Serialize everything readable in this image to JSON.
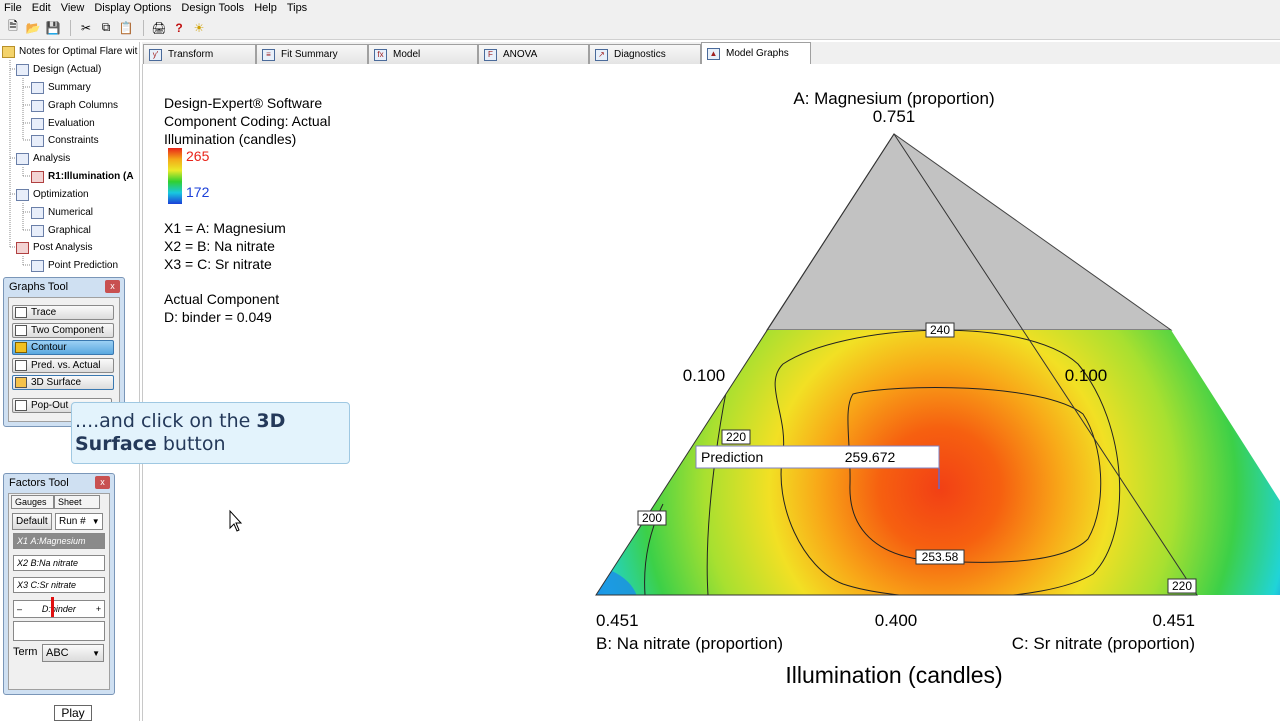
{
  "menu": [
    "File",
    "Edit",
    "View",
    "Display Options",
    "Design Tools",
    "Help",
    "Tips"
  ],
  "toolbar_icons": [
    "new-file-icon",
    "open-folder-icon",
    "save-icon",
    "cut-icon",
    "copy-icon",
    "paste-icon",
    "print-icon",
    "help-icon",
    "tip-bulb-icon"
  ],
  "tree": {
    "root": "Notes for Optimal Flare wit",
    "design": "Design (Actual)",
    "summary": "Summary",
    "graph_columns": "Graph Columns",
    "evaluation": "Evaluation",
    "constraints": "Constraints",
    "analysis": "Analysis",
    "response": "R1:Illumination (A",
    "optimization": "Optimization",
    "numerical": "Numerical",
    "graphical": "Graphical",
    "post_analysis": "Post Analysis",
    "point_prediction": "Point Prediction"
  },
  "graphs_tool": {
    "title": "Graphs Tool",
    "close": "x",
    "buttons": [
      "Trace",
      "Two Component",
      "Contour",
      "Pred. vs. Actual",
      "3D Surface",
      "Pop-Out"
    ]
  },
  "callout": {
    "line1": "....and click on the ",
    "bold1": "3D",
    "bold2": "Surface",
    "line2": " button"
  },
  "factors_tool": {
    "title": "Factors Tool",
    "close": "x",
    "tab_gauges": "Gauges",
    "tab_sheet": "Sheet",
    "default_btn": "Default",
    "run_select": "Run #",
    "factors": [
      {
        "code": "X1",
        "name": "A:Magnesium"
      },
      {
        "code": "X2",
        "name": "B:Na nitrate"
      },
      {
        "code": "X3",
        "name": "C:Sr nitrate"
      }
    ],
    "slider_minus": "–",
    "slider_label": "D:binder",
    "slider_plus": "+",
    "term_label": "Term",
    "term_value": "ABC"
  },
  "play_button": "Play",
  "tabs": [
    "Transform",
    "Fit Summary",
    "Model",
    "ANOVA",
    "Diagnostics",
    "Model Graphs"
  ],
  "active_tab": "Model Graphs",
  "legend": {
    "software": "Design-Expert® Software",
    "coding": "Component Coding: Actual",
    "response": "Illumination (candles)",
    "max_value": "265",
    "min_value": "172",
    "x1": "X1 = A: Magnesium",
    "x2": "X2 = B: Na nitrate",
    "x3": "X3 = C: Sr nitrate",
    "actual_component": "Actual Component",
    "binder": "D: binder = 0.049"
  },
  "plot": {
    "top_label": "A: Magnesium (proportion)",
    "top_value": "0.751",
    "left_value": "0.100",
    "right_value": "0.100",
    "bottom_left_value": "0.451",
    "bottom_mid_value": "0.400",
    "bottom_right_value": "0.451",
    "bottom_left_label": "B: Na nitrate (proportion)",
    "bottom_right_label": "C: Sr nitrate (proportion)",
    "title": "Illumination (candles)",
    "contour_labels": [
      "240",
      "220",
      "200",
      "253.58",
      "220"
    ],
    "prediction_label": "Prediction",
    "prediction_value": "259.672"
  },
  "colors": {
    "high": "#e8241a",
    "low": "#1a3fd8",
    "excluded": "#c2c2c2"
  }
}
